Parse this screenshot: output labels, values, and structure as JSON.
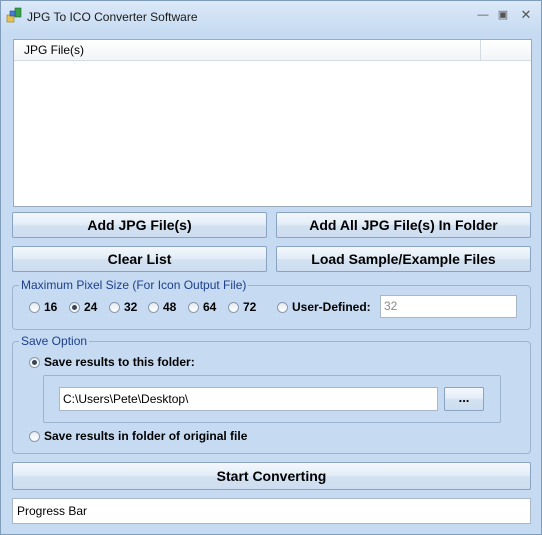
{
  "window": {
    "title": "JPG To ICO Converter Software",
    "minimize_icon": "minimize-icon",
    "maximize_icon": "maximize-icon",
    "close_icon": "close-icon"
  },
  "file_list": {
    "column_header": "JPG File(s)"
  },
  "buttons": {
    "add_files": "Add JPG File(s)",
    "add_folder": "Add All JPG File(s) In Folder",
    "clear_list": "Clear List",
    "load_sample": "Load Sample/Example Files",
    "start": "Start Converting",
    "browse": "..."
  },
  "pixel_size": {
    "legend": "Maximum Pixel Size (For Icon Output File)",
    "options": [
      "16",
      "24",
      "32",
      "48",
      "64",
      "72"
    ],
    "selected": "24",
    "user_defined_label": "User-Defined:",
    "user_defined_value": "32"
  },
  "save_option": {
    "legend": "Save Option",
    "this_folder_label": "Save results to this folder:",
    "folder_path": "C:\\Users\\Pete\\Desktop\\",
    "original_folder_label": "Save results in folder of original file",
    "selected": "this_folder"
  },
  "progress": {
    "label": "Progress Bar"
  },
  "colors": {
    "window_bg": "#c6dbf2",
    "group_legend": "#1c3f8a"
  }
}
